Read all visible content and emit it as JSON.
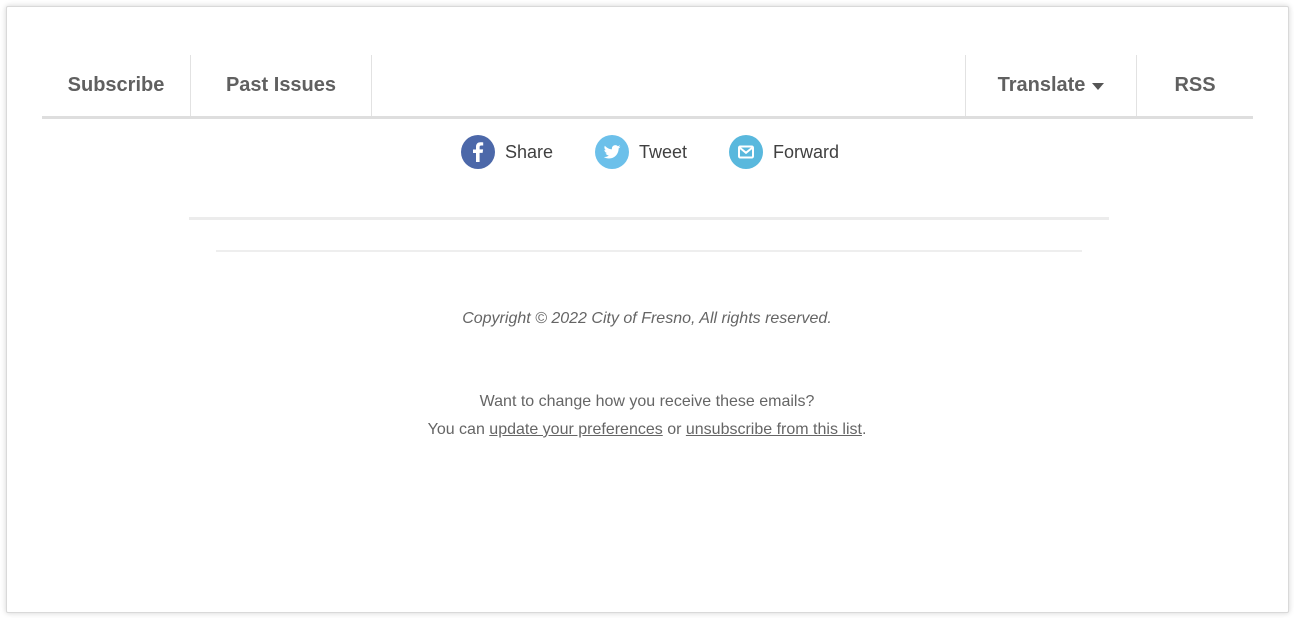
{
  "nav": {
    "subscribe": "Subscribe",
    "past_issues": "Past Issues",
    "translate": "Translate",
    "rss": "RSS"
  },
  "share": [
    {
      "label": "Share",
      "icon": "facebook-icon",
      "color": "#3b5998"
    },
    {
      "label": "Tweet",
      "icon": "twitter-icon",
      "color": "#55acee"
    },
    {
      "label": "Forward",
      "icon": "email-icon",
      "color": "#49b3d6"
    }
  ],
  "footer": {
    "copyright": "Copyright © 2022 City of Fresno, All rights reserved.",
    "change_question": "Want to change how you receive these emails?",
    "you_can": "You can ",
    "update_link": "update your preferences",
    "or": " or ",
    "unsubscribe_link": "unsubscribe from this list",
    "period": "."
  }
}
